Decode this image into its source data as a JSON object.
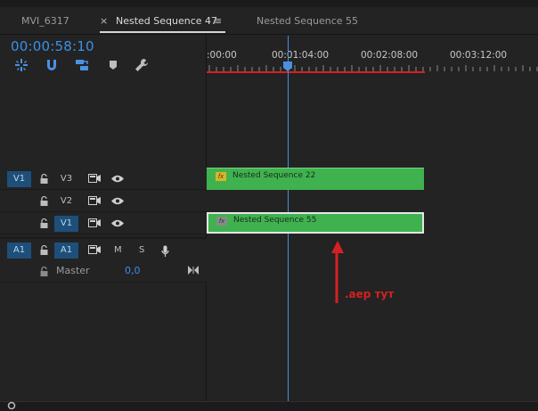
{
  "tabs": [
    {
      "label": "MVI_6317"
    },
    {
      "label": "Nested Sequence 47",
      "close": "×",
      "menu": "≡",
      "active": true
    },
    {
      "label": "Nested Sequence 55"
    }
  ],
  "timecode": "00:00:58:10",
  "ruler": {
    "labels": [
      ":00:00",
      "00:01:04:00",
      "00:02:08:00",
      "00:03:12:00"
    ]
  },
  "tracks": {
    "v3": {
      "name": "V3"
    },
    "v2": {
      "name": "V2"
    },
    "v1": {
      "name": "V1",
      "patch": "V1"
    },
    "a1": {
      "name": "A1",
      "patch": "A1",
      "mute": "M",
      "solo": "S"
    },
    "master": {
      "name": "Master",
      "value": "0,0"
    }
  },
  "clips": [
    {
      "name": "Nested Sequence 22",
      "fx": "fx"
    },
    {
      "name": "Nested Sequence 55",
      "fx": "fx"
    }
  ],
  "annotation": {
    "text": ".аер тут",
    "color": "#d42121"
  },
  "colors": {
    "accent": "#3d8fe8",
    "clip": "#3fb24f",
    "workarea": "#d42121",
    "patch": "#1d4f7a"
  }
}
